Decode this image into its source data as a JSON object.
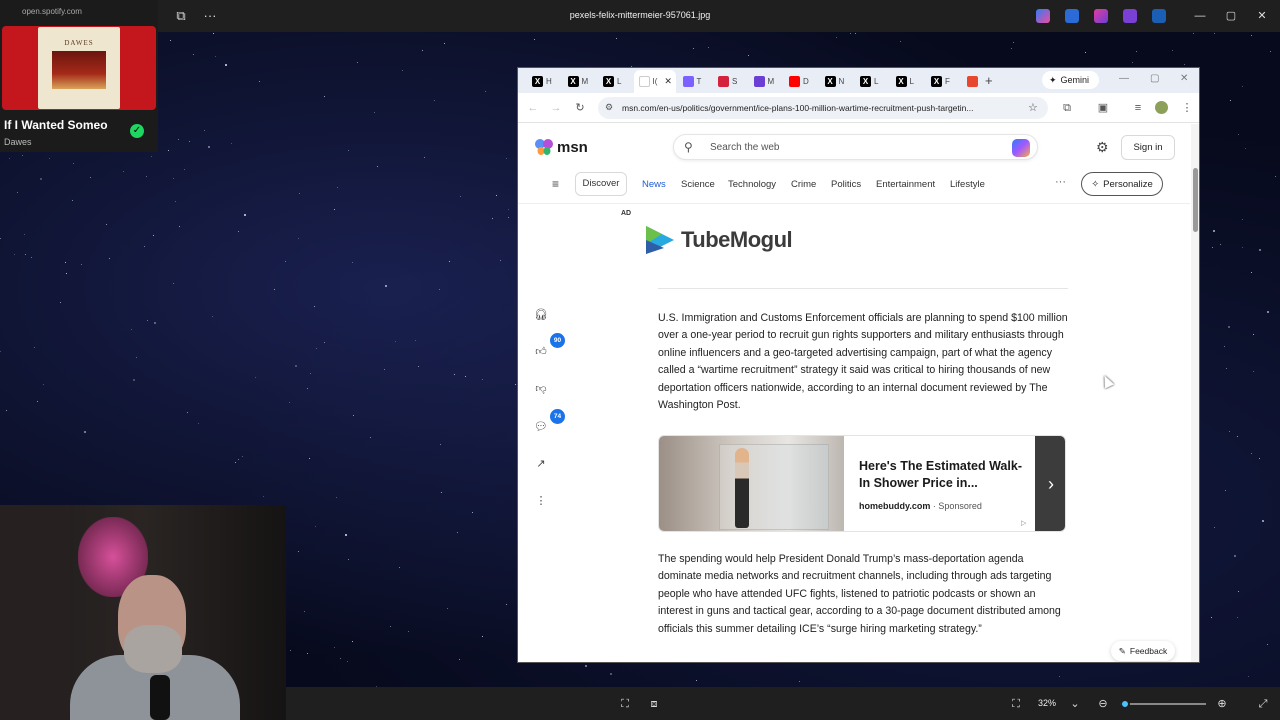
{
  "viewer": {
    "file_title": "pexels-felix-mittermeier-957061.jpg",
    "zoom_value": "32%",
    "zoom_level": 0.06
  },
  "spotify": {
    "url": "open.spotify.com",
    "album_art_text": "DAWES",
    "track_title": "If I Wanted Someo",
    "artist": "Dawes"
  },
  "browser": {
    "tabs": [
      {
        "icon": "x-logo-icon",
        "label": "H",
        "color": "#000000"
      },
      {
        "icon": "x-logo-icon",
        "label": "M",
        "color": "#000000"
      },
      {
        "icon": "x-logo-icon",
        "label": "L",
        "color": "#000000"
      },
      {
        "icon": "msn-icon",
        "label": "I(",
        "color": "#ffffff",
        "active": true
      },
      {
        "icon": "copilot-icon",
        "label": "T",
        "color": "#7b61ff"
      },
      {
        "icon": "puzzle-icon",
        "label": "S",
        "color": "#d4213d"
      },
      {
        "icon": "f-logo-icon",
        "label": "M",
        "color": "#6b3fd4"
      },
      {
        "icon": "youtube-icon",
        "label": "D",
        "color": "#ff0000"
      },
      {
        "icon": "x-logo-icon",
        "label": "N",
        "color": "#000000"
      },
      {
        "icon": "x-logo-icon",
        "label": "L",
        "color": "#000000"
      },
      {
        "icon": "x-logo-icon",
        "label": "L",
        "color": "#000000"
      },
      {
        "icon": "x-logo-icon",
        "label": "F",
        "color": "#000000"
      },
      {
        "icon": "c-logo-icon",
        "label": "",
        "color": "#e8472f"
      }
    ],
    "gemini_label": "Gemini",
    "url": "msn.com/en-us/politics/government/ice-plans-100-million-wartime-recruitment-push-targetin..."
  },
  "msn": {
    "logo_text": "msn",
    "search_placeholder": "Search the web",
    "sign_in": "Sign in",
    "nav": {
      "discover": "Discover",
      "items": [
        "News",
        "Science",
        "Technology",
        "Crime",
        "Politics",
        "Entertainment",
        "Lifestyle"
      ],
      "more": "···",
      "personalize": "Personalize"
    },
    "ad_label": "AD",
    "tubemogul_text": "TubeMogul",
    "rail": {
      "likes": "90",
      "comments": "74"
    },
    "paragraph1": "U.S. Immigration and Customs Enforcement officials are planning to spend $100 million over a one-year period to recruit gun rights supporters and military enthusiasts through online influencers and a geo-targeted advertising campaign, part of what the agency called a “wartime recruitment” strategy it said was critical to hiring thousands of new deportation officers nationwide, according to an internal document reviewed by The Washington Post.",
    "ad_card": {
      "title": "Here's The Estimated Walk-In Shower Price in...",
      "source": "homebuddy.com",
      "sponsored": "· Sponsored"
    },
    "paragraph2": "The spending would help President Donald Trump’s mass-deportation agenda dominate media networks and recruitment channels, including through ads targeting people who have attended UFC fights, listened to patriotic podcasts or shown an interest in guns and tactical gear, according to a 30-page document distributed among officials this summer detailing ICE’s “surge hiring marketing strategy.”",
    "feedback": "Feedback"
  },
  "colors": {
    "accent_blue": "#1f5fd1",
    "badge_blue": "#1a73e8",
    "spotify_green": "#1ed760"
  }
}
